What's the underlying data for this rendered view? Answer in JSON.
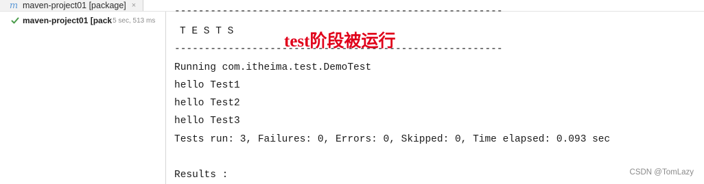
{
  "tab": {
    "icon": "m",
    "icon_name": "maven-icon",
    "title": "maven-project01 [package]",
    "close_glyph": "×"
  },
  "run_tree": {
    "status": "success",
    "item_name": "maven-project01 [pack",
    "elapsed": "5 sec, 513 ms",
    "status_color": "#4a9c4a"
  },
  "console": {
    "separator_top": "-------------------------------------------------------",
    "tests_header": "T E S T S",
    "separator_bottom": "-------------------------------------------------------",
    "running": "Running com.itheima.test.DemoTest",
    "out1": "hello Test1",
    "out2": "hello Test2",
    "out3": "hello Test3",
    "summary": "Tests run: 3, Failures: 0, Errors: 0, Skipped: 0, Time elapsed: 0.093 sec",
    "results": "Results :"
  },
  "annotation": {
    "text": "test阶段被运行",
    "color": "#e0001a"
  },
  "watermark": "CSDN @TomLazy"
}
